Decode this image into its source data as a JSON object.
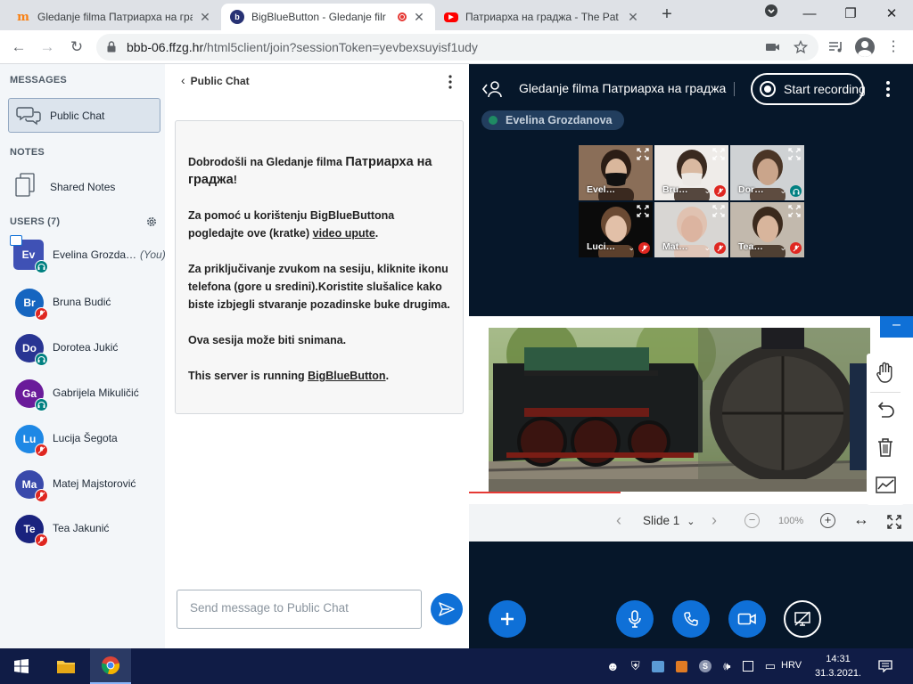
{
  "browser": {
    "tabs": [
      {
        "title": "Gledanje filma Патриарха на граде",
        "favicon": "moodle-icon",
        "active": false
      },
      {
        "title": "BigBlueButton - Gledanje filr",
        "favicon": "bigbluebutton-icon",
        "active": true,
        "recording": true
      },
      {
        "title": "Патриарха на граджа - The Pat",
        "favicon": "youtube-icon",
        "active": false
      }
    ],
    "url_host": "bbb-06.ffzg.hr",
    "url_path": "/html5client/join?sessionToken=yevbexsuyisf1udy"
  },
  "sidebar": {
    "messages_title": "MESSAGES",
    "public_chat_label": "Public Chat",
    "notes_title": "NOTES",
    "shared_notes_label": "Shared Notes",
    "users_title": "USERS (7)",
    "users": [
      {
        "initials": "Ev",
        "name": "Evelina Grozda…",
        "you": "(You)",
        "color": "#3f51b5",
        "status": "listen",
        "presenter": true
      },
      {
        "initials": "Br",
        "name": "Bruna Budić",
        "color": "#1565c0",
        "status": "muted"
      },
      {
        "initials": "Do",
        "name": "Dorotea Jukić",
        "color": "#283593",
        "status": "listen"
      },
      {
        "initials": "Ga",
        "name": "Gabrijela Mikuličić",
        "color": "#6a1b9a",
        "status": "listen"
      },
      {
        "initials": "Lu",
        "name": "Lucija Šegota",
        "color": "#1e88e5",
        "status": "muted"
      },
      {
        "initials": "Ma",
        "name": "Matej Majstorović",
        "color": "#3949ab",
        "status": "muted"
      },
      {
        "initials": "Te",
        "name": "Tea Jakunić",
        "color": "#1a237e",
        "status": "muted"
      }
    ]
  },
  "chat": {
    "header": "Public Chat",
    "welcome": {
      "p1_prefix": "Dobrodošli na ",
      "p1_title_a": "Gledanje filma ",
      "p1_title_b": "Патриарха на граджа",
      "p1_suffix": "!",
      "p2_text": "Za pomoć u korištenju BigBlueButtona pogledajte ove (kratke) ",
      "p2_link": "video upute",
      "p2_end": ".",
      "p3_text": "Za priključivanje zvukom na sesiju, kliknite ikonu telefona (gore u sredini).Koristite slušalice kako biste izbjegli stvaranje pozadinske buke drugima.",
      "p4_text": "Ova sesija može biti snimana.",
      "p5_text": "This server is running ",
      "p5_link": "BigBlueButton",
      "p5_end": "."
    },
    "input_placeholder": "Send message to Public Chat"
  },
  "meeting": {
    "title": "Gledanje filma Патриарха на граджа",
    "start_recording": "Start recording",
    "talking": "Evelina Grozdanova",
    "webcams": [
      {
        "name": "Evel…",
        "mic": "none",
        "bg": "#8a6e58",
        "skin": "#d9b79c",
        "hair": "#2b1d15",
        "mask": "#111"
      },
      {
        "name": "Bru…",
        "mic": "muted",
        "bg": "#efece9",
        "skin": "#d9b9a1",
        "hair": "#3a2a20",
        "mask": "#ece8e4"
      },
      {
        "name": "Dor…",
        "mic": "listen",
        "bg": "#cfd2d4",
        "skin": "#caa58b",
        "hair": "#4a3526",
        "mask": ""
      },
      {
        "name": "Luci…",
        "mic": "muted",
        "bg": "#0b0b0b",
        "skin": "#e2c0a8",
        "hair": "#6b4a33",
        "mask": ""
      },
      {
        "name": "Mat…",
        "mic": "muted",
        "bg": "#d8d6d3",
        "skin": "#dcb4a0",
        "hair": "#e0c2b1",
        "mask": ""
      },
      {
        "name": "Tea…",
        "mic": "muted",
        "bg": "#c2b9ad",
        "skin": "#d8b59c",
        "hair": "#3b2a1d",
        "mask": ""
      }
    ],
    "slide_label": "Slide 1",
    "zoom": "100%"
  },
  "taskbar": {
    "lang": "HRV",
    "time": "14:31",
    "date": "31.3.2021."
  },
  "colors": {
    "bbb_blue": "#0f70d7",
    "muted_red": "#df2721",
    "listen_green": "#008081",
    "main_bg": "#06172a"
  }
}
